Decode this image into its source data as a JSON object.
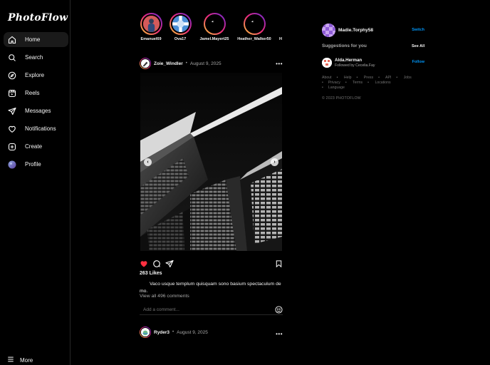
{
  "app": {
    "logo": "PhotoFlow"
  },
  "sidebar": {
    "items": [
      {
        "label": "Home",
        "icon": "home-icon",
        "active": true
      },
      {
        "label": "Search",
        "icon": "search-icon"
      },
      {
        "label": "Explore",
        "icon": "compass-icon"
      },
      {
        "label": "Reels",
        "icon": "reels-icon"
      },
      {
        "label": "Messages",
        "icon": "send-icon"
      },
      {
        "label": "Notifications",
        "icon": "heart-icon"
      },
      {
        "label": "Create",
        "icon": "plus-square-icon"
      },
      {
        "label": "Profile",
        "icon": "avatar-icon"
      }
    ],
    "more_label": "More"
  },
  "stories": [
    {
      "name": "Emanuel69"
    },
    {
      "name": "Ova17"
    },
    {
      "name": "Jamel.Mayert25"
    },
    {
      "name": "Heather_Walker50"
    },
    {
      "name": "H"
    }
  ],
  "post": {
    "user": "Zoie_Windler",
    "date": "August 9, 2025",
    "likes": "263 Likes",
    "caption": "Vaco usque templum quisquam sono basium spectaculum demo.",
    "comments_link": "View all 496 comments",
    "comment_placeholder": "Add a comment...",
    "liked": true
  },
  "next_post": {
    "user": "Ryder3",
    "date": "August 9, 2025"
  },
  "right_panel": {
    "current_user": "Madie.Torphy58",
    "switch_label": "Switch",
    "suggestions_title": "Suggestions for you",
    "see_all_label": "See All",
    "suggestions": [
      {
        "name": "Alda.Herman",
        "sub": "Followed by Cecelia.Fay",
        "action": "Follow"
      }
    ],
    "footer_links": [
      "About",
      "Help",
      "Press",
      "API",
      "Jobs",
      "Privacy",
      "Terms",
      "Locations",
      "Language"
    ],
    "copyright": "© 2023 PHOTOFLOW"
  },
  "colors": {
    "background": "#000000",
    "link_blue": "#0095f6",
    "like_red": "#ff3040",
    "muted": "#a8a8a8"
  }
}
